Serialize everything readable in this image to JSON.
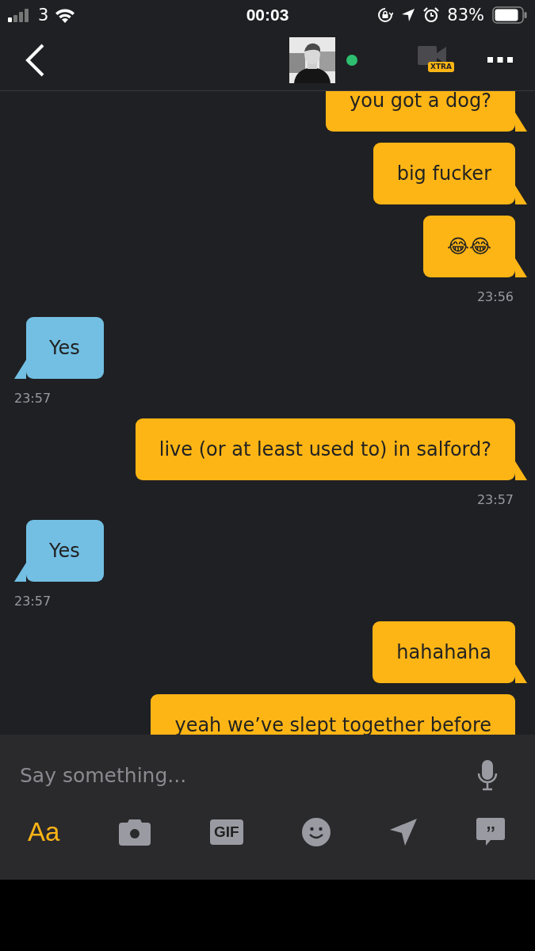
{
  "status_bar": {
    "carrier": "3",
    "time": "00:03",
    "battery": "83%"
  },
  "header": {
    "online": true
  },
  "messages": [
    {
      "kind": "message",
      "outgoing": true,
      "text": "you got a dog?"
    },
    {
      "kind": "message",
      "outgoing": true,
      "text": "big fucker"
    },
    {
      "kind": "message",
      "outgoing": true,
      "text": "😂😂"
    },
    {
      "kind": "time",
      "outgoing": true,
      "text": "23:56"
    },
    {
      "kind": "message",
      "outgoing": false,
      "text": "Yes"
    },
    {
      "kind": "time",
      "outgoing": false,
      "text": "23:57"
    },
    {
      "kind": "message",
      "outgoing": true,
      "text": "live (or at least used to) in salford?"
    },
    {
      "kind": "time",
      "outgoing": true,
      "text": "23:57"
    },
    {
      "kind": "message",
      "outgoing": false,
      "text": "Yes"
    },
    {
      "kind": "time",
      "outgoing": false,
      "text": "23:57"
    },
    {
      "kind": "message",
      "outgoing": true,
      "text": "hahahaha"
    },
    {
      "kind": "message",
      "outgoing": true,
      "text": "yeah we’ve slept together before"
    }
  ],
  "composer": {
    "placeholder": "Say something..."
  },
  "toolbar": [
    {
      "kind": "text",
      "label": "Aa",
      "selected": true
    },
    {
      "kind": "camera",
      "selected": false
    },
    {
      "kind": "gif",
      "label": "GIF",
      "selected": false
    },
    {
      "kind": "emoji",
      "selected": false
    },
    {
      "kind": "location",
      "selected": false
    },
    {
      "kind": "phrases",
      "selected": false
    }
  ],
  "video_badge": "XTRA"
}
